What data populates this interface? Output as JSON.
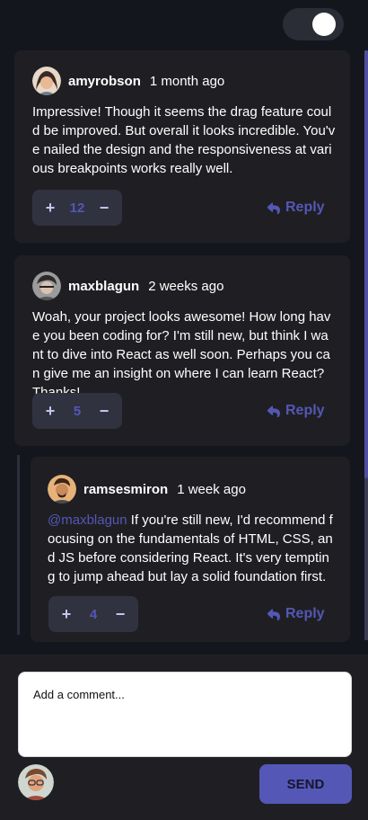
{
  "comments": [
    {
      "username": "amyrobson",
      "time": "1 month ago",
      "text": "Impressive! Though it seems the drag feature could be improved. But overall it looks incredible. You've nailed the design and the responsiveness at various breakpoints works really well.",
      "score": "12",
      "reply_label": "Reply"
    },
    {
      "username": "maxblagun",
      "time": "2 weeks ago",
      "text": "Woah, your project looks awesome! How long have you been coding for? I'm still new, but think I want to dive into React as well soon. Perhaps you can give me an insight on where I can learn React? Thanks!",
      "score": "5",
      "reply_label": "Reply"
    }
  ],
  "reply": {
    "username": "ramsesmiron",
    "time": "1 week ago",
    "mention": "@maxblagun",
    "text": "If you're still new, I'd recommend focusing on the fundamentals of HTML, CSS, and JS before considering React. It's very tempting to jump ahead but lay a solid foundation first.",
    "score": "4",
    "reply_label": "Reply"
  },
  "vote": {
    "plus": "+",
    "minus": "−"
  },
  "composer": {
    "placeholder": "Add a comment...",
    "send_label": "SEND"
  },
  "colors": {
    "accent": "#5457b6",
    "card": "#1f1f23",
    "background": "#14161d"
  },
  "icons": {
    "reply": "reply-icon",
    "theme_toggle": "theme-toggle"
  }
}
